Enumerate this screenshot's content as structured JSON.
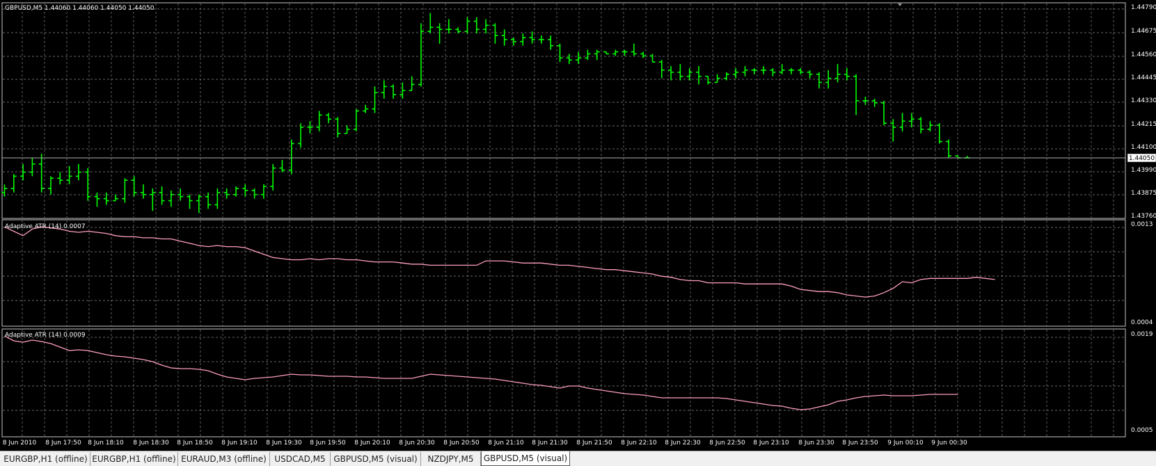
{
  "main_pane": {
    "title": "GBPUSD,M5  1.44060 1.44060 1.44050 1.44050",
    "price_ticks": [
      "1.44790",
      "1.44675",
      "1.44560",
      "1.44445",
      "1.44330",
      "1.44215",
      "1.44100",
      "1.43990",
      "1.43875",
      "1.43760"
    ],
    "current_price": "1.44050"
  },
  "indicator1": {
    "title": "Adaptive ATR (14) 0.0007",
    "ticks": [
      "0.0013",
      "0.0004"
    ]
  },
  "indicator2": {
    "title": "Adaptive ATR (14) 0.0009",
    "ticks": [
      "0.0019",
      "0.0005"
    ]
  },
  "time_axis": [
    "8 Jun 2010",
    "8 Jun 17:50",
    "8 Jun 18:10",
    "8 Jun 18:30",
    "8 Jun 18:50",
    "8 Jun 19:10",
    "8 Jun 19:30",
    "8 Jun 19:50",
    "8 Jun 20:10",
    "8 Jun 20:30",
    "8 Jun 20:50",
    "8 Jun 21:10",
    "8 Jun 21:30",
    "8 Jun 21:50",
    "8 Jun 22:10",
    "8 Jun 22:30",
    "8 Jun 22:50",
    "8 Jun 23:10",
    "8 Jun 23:30",
    "8 Jun 23:50",
    "9 Jun 00:10",
    "9 Jun 00:30"
  ],
  "tabs": [
    {
      "label": "EURGBP,H1 (offline)",
      "active": false
    },
    {
      "label": "EURGBP,H1 (offline)",
      "active": false
    },
    {
      "label": "EURAUD,M3 (offline)",
      "active": false
    },
    {
      "label": "USDCAD,M5",
      "active": false
    },
    {
      "label": "GBPUSD,M5 (visual)",
      "active": false
    },
    {
      "label": "NZDJPY,M5",
      "active": false
    },
    {
      "label": "GBPUSD,M5 (visual)",
      "active": true
    }
  ],
  "colors": {
    "background": "#000000",
    "grid": "#8a8a8a",
    "bars": "#00ff00",
    "indicator_line": "#ff9ec4",
    "text": "#ffffff"
  },
  "chart_data": [
    {
      "type": "bar",
      "title": "GBPUSD,M5",
      "ylim": [
        1.4376,
        1.4479
      ],
      "bars": [
        {
          "o": 1.4388,
          "h": 1.4392,
          "l": 1.4386,
          "c": 1.439
        },
        {
          "o": 1.439,
          "h": 1.4397,
          "l": 1.4388,
          "c": 1.4396
        },
        {
          "o": 1.4396,
          "h": 1.4402,
          "l": 1.4394,
          "c": 1.4398
        },
        {
          "o": 1.4398,
          "h": 1.4405,
          "l": 1.4396,
          "c": 1.4402
        },
        {
          "o": 1.4402,
          "h": 1.4407,
          "l": 1.4388,
          "c": 1.439
        },
        {
          "o": 1.439,
          "h": 1.4396,
          "l": 1.4387,
          "c": 1.4395
        },
        {
          "o": 1.4395,
          "h": 1.4398,
          "l": 1.4392,
          "c": 1.4394
        },
        {
          "o": 1.4394,
          "h": 1.4401,
          "l": 1.4392,
          "c": 1.4396
        },
        {
          "o": 1.4396,
          "h": 1.4402,
          "l": 1.4394,
          "c": 1.4398
        },
        {
          "o": 1.4398,
          "h": 1.44,
          "l": 1.4384,
          "c": 1.4386
        },
        {
          "o": 1.4386,
          "h": 1.4388,
          "l": 1.4381,
          "c": 1.4385
        },
        {
          "o": 1.4385,
          "h": 1.4388,
          "l": 1.4382,
          "c": 1.4384
        },
        {
          "o": 1.4384,
          "h": 1.4387,
          "l": 1.4384,
          "c": 1.4385
        },
        {
          "o": 1.4385,
          "h": 1.4395,
          "l": 1.4383,
          "c": 1.4394
        },
        {
          "o": 1.4394,
          "h": 1.4396,
          "l": 1.4386,
          "c": 1.4388
        },
        {
          "o": 1.4388,
          "h": 1.4392,
          "l": 1.4385,
          "c": 1.4387
        },
        {
          "o": 1.4387,
          "h": 1.439,
          "l": 1.4379,
          "c": 1.4388
        },
        {
          "o": 1.4388,
          "h": 1.4391,
          "l": 1.4382,
          "c": 1.4384
        },
        {
          "o": 1.4384,
          "h": 1.4389,
          "l": 1.4381,
          "c": 1.4387
        },
        {
          "o": 1.4387,
          "h": 1.439,
          "l": 1.4384,
          "c": 1.4386
        },
        {
          "o": 1.4386,
          "h": 1.4387,
          "l": 1.438,
          "c": 1.4384
        },
        {
          "o": 1.4384,
          "h": 1.4387,
          "l": 1.4378,
          "c": 1.4386
        },
        {
          "o": 1.4386,
          "h": 1.4388,
          "l": 1.438,
          "c": 1.4382
        },
        {
          "o": 1.4382,
          "h": 1.439,
          "l": 1.438,
          "c": 1.4388
        },
        {
          "o": 1.4388,
          "h": 1.439,
          "l": 1.4385,
          "c": 1.4387
        },
        {
          "o": 1.4387,
          "h": 1.4391,
          "l": 1.4386,
          "c": 1.439
        },
        {
          "o": 1.439,
          "h": 1.4392,
          "l": 1.4386,
          "c": 1.4389
        },
        {
          "o": 1.4389,
          "h": 1.439,
          "l": 1.4385,
          "c": 1.4387
        },
        {
          "o": 1.4387,
          "h": 1.4392,
          "l": 1.4385,
          "c": 1.4391
        },
        {
          "o": 1.4391,
          "h": 1.4402,
          "l": 1.4389,
          "c": 1.44
        },
        {
          "o": 1.44,
          "h": 1.4404,
          "l": 1.4398,
          "c": 1.4399
        },
        {
          "o": 1.4399,
          "h": 1.4414,
          "l": 1.4397,
          "c": 1.4412
        },
        {
          "o": 1.4412,
          "h": 1.4422,
          "l": 1.441,
          "c": 1.442
        },
        {
          "o": 1.442,
          "h": 1.4423,
          "l": 1.4417,
          "c": 1.442
        },
        {
          "o": 1.442,
          "h": 1.4428,
          "l": 1.4418,
          "c": 1.4426
        },
        {
          "o": 1.4426,
          "h": 1.4427,
          "l": 1.4422,
          "c": 1.4424
        },
        {
          "o": 1.4424,
          "h": 1.4425,
          "l": 1.4415,
          "c": 1.4417
        },
        {
          "o": 1.4417,
          "h": 1.4421,
          "l": 1.4417,
          "c": 1.4419
        },
        {
          "o": 1.4419,
          "h": 1.4429,
          "l": 1.4418,
          "c": 1.4428
        },
        {
          "o": 1.4428,
          "h": 1.4431,
          "l": 1.4427,
          "c": 1.4429
        },
        {
          "o": 1.4429,
          "h": 1.444,
          "l": 1.4427,
          "c": 1.4437
        },
        {
          "o": 1.4437,
          "h": 1.4443,
          "l": 1.4434,
          "c": 1.444
        },
        {
          "o": 1.444,
          "h": 1.4441,
          "l": 1.4434,
          "c": 1.4436
        },
        {
          "o": 1.4436,
          "h": 1.4442,
          "l": 1.4434,
          "c": 1.4438
        },
        {
          "o": 1.4438,
          "h": 1.4445,
          "l": 1.4438,
          "c": 1.4441
        },
        {
          "o": 1.4441,
          "h": 1.4471,
          "l": 1.444,
          "c": 1.4467
        },
        {
          "o": 1.4467,
          "h": 1.4476,
          "l": 1.4466,
          "c": 1.4469
        },
        {
          "o": 1.4469,
          "h": 1.4471,
          "l": 1.4461,
          "c": 1.4468
        },
        {
          "o": 1.4468,
          "h": 1.4473,
          "l": 1.4466,
          "c": 1.4468
        },
        {
          "o": 1.4468,
          "h": 1.4469,
          "l": 1.4466,
          "c": 1.4467
        },
        {
          "o": 1.4467,
          "h": 1.4474,
          "l": 1.4466,
          "c": 1.4472
        },
        {
          "o": 1.4472,
          "h": 1.4474,
          "l": 1.4466,
          "c": 1.4468
        },
        {
          "o": 1.4468,
          "h": 1.4473,
          "l": 1.4466,
          "c": 1.447
        },
        {
          "o": 1.447,
          "h": 1.4471,
          "l": 1.4461,
          "c": 1.4465
        },
        {
          "o": 1.4465,
          "h": 1.4468,
          "l": 1.446,
          "c": 1.4463
        },
        {
          "o": 1.4463,
          "h": 1.4464,
          "l": 1.446,
          "c": 1.4462
        },
        {
          "o": 1.4462,
          "h": 1.4466,
          "l": 1.446,
          "c": 1.4464
        },
        {
          "o": 1.4464,
          "h": 1.4467,
          "l": 1.4461,
          "c": 1.4463
        },
        {
          "o": 1.4463,
          "h": 1.4465,
          "l": 1.4461,
          "c": 1.4463
        },
        {
          "o": 1.4463,
          "h": 1.4465,
          "l": 1.4458,
          "c": 1.446
        },
        {
          "o": 1.446,
          "h": 1.4461,
          "l": 1.4452,
          "c": 1.4454
        },
        {
          "o": 1.4454,
          "h": 1.4456,
          "l": 1.4451,
          "c": 1.4453
        },
        {
          "o": 1.4453,
          "h": 1.4457,
          "l": 1.4451,
          "c": 1.4454
        },
        {
          "o": 1.4454,
          "h": 1.4458,
          "l": 1.4453,
          "c": 1.4456
        },
        {
          "o": 1.4456,
          "h": 1.4458,
          "l": 1.4453,
          "c": 1.4457
        },
        {
          "o": 1.4457,
          "h": 1.4457,
          "l": 1.4456,
          "c": 1.4456
        },
        {
          "o": 1.4456,
          "h": 1.4458,
          "l": 1.4455,
          "c": 1.4457
        },
        {
          "o": 1.4457,
          "h": 1.4458,
          "l": 1.4455,
          "c": 1.4457
        },
        {
          "o": 1.4457,
          "h": 1.4461,
          "l": 1.4455,
          "c": 1.4456
        },
        {
          "o": 1.4456,
          "h": 1.4457,
          "l": 1.4454,
          "c": 1.4455
        },
        {
          "o": 1.4455,
          "h": 1.4456,
          "l": 1.4452,
          "c": 1.4452
        },
        {
          "o": 1.4452,
          "h": 1.4453,
          "l": 1.4444,
          "c": 1.4448
        },
        {
          "o": 1.4448,
          "h": 1.445,
          "l": 1.4443,
          "c": 1.4447
        },
        {
          "o": 1.4447,
          "h": 1.4451,
          "l": 1.4443,
          "c": 1.4445
        },
        {
          "o": 1.4445,
          "h": 1.4449,
          "l": 1.4443,
          "c": 1.4447
        },
        {
          "o": 1.4447,
          "h": 1.445,
          "l": 1.4441,
          "c": 1.4445
        },
        {
          "o": 1.4445,
          "h": 1.4445,
          "l": 1.4441,
          "c": 1.4442
        },
        {
          "o": 1.4442,
          "h": 1.4446,
          "l": 1.4442,
          "c": 1.4444
        },
        {
          "o": 1.4444,
          "h": 1.4447,
          "l": 1.4443,
          "c": 1.4446
        },
        {
          "o": 1.4446,
          "h": 1.4449,
          "l": 1.4444,
          "c": 1.4447
        },
        {
          "o": 1.4447,
          "h": 1.445,
          "l": 1.4445,
          "c": 1.4448
        },
        {
          "o": 1.4448,
          "h": 1.4449,
          "l": 1.4446,
          "c": 1.4448
        },
        {
          "o": 1.4448,
          "h": 1.445,
          "l": 1.4446,
          "c": 1.4448
        },
        {
          "o": 1.4448,
          "h": 1.4449,
          "l": 1.4445,
          "c": 1.4447
        },
        {
          "o": 1.4447,
          "h": 1.4451,
          "l": 1.4446,
          "c": 1.4448
        },
        {
          "o": 1.4448,
          "h": 1.4449,
          "l": 1.4446,
          "c": 1.4448
        },
        {
          "o": 1.4448,
          "h": 1.4449,
          "l": 1.4446,
          "c": 1.4447
        },
        {
          "o": 1.4447,
          "h": 1.4448,
          "l": 1.4444,
          "c": 1.4446
        },
        {
          "o": 1.4446,
          "h": 1.4447,
          "l": 1.4439,
          "c": 1.4442
        },
        {
          "o": 1.4442,
          "h": 1.4448,
          "l": 1.4439,
          "c": 1.4444
        },
        {
          "o": 1.4444,
          "h": 1.4451,
          "l": 1.4442,
          "c": 1.4446
        },
        {
          "o": 1.4446,
          "h": 1.4449,
          "l": 1.4443,
          "c": 1.4445
        },
        {
          "o": 1.4445,
          "h": 1.4446,
          "l": 1.4426,
          "c": 1.4433
        },
        {
          "o": 1.4433,
          "h": 1.4435,
          "l": 1.4431,
          "c": 1.4433
        },
        {
          "o": 1.4433,
          "h": 1.4434,
          "l": 1.443,
          "c": 1.4432
        },
        {
          "o": 1.4432,
          "h": 1.4433,
          "l": 1.4421,
          "c": 1.4422
        },
        {
          "o": 1.4422,
          "h": 1.4424,
          "l": 1.4413,
          "c": 1.442
        },
        {
          "o": 1.442,
          "h": 1.4427,
          "l": 1.4418,
          "c": 1.4423
        },
        {
          "o": 1.4423,
          "h": 1.4427,
          "l": 1.442,
          "c": 1.4424
        },
        {
          "o": 1.4424,
          "h": 1.4425,
          "l": 1.4417,
          "c": 1.4419
        },
        {
          "o": 1.4419,
          "h": 1.4423,
          "l": 1.4418,
          "c": 1.4421
        },
        {
          "o": 1.4421,
          "h": 1.4422,
          "l": 1.4412,
          "c": 1.4413
        },
        {
          "o": 1.4413,
          "h": 1.4414,
          "l": 1.4405,
          "c": 1.4406
        },
        {
          "o": 1.4406,
          "h": 1.4406,
          "l": 1.4405,
          "c": 1.4405
        },
        {
          "o": 1.4405,
          "h": 1.4406,
          "l": 1.4405,
          "c": 1.4405
        }
      ]
    },
    {
      "type": "line",
      "title": "Adaptive ATR (14)",
      "ylim": [
        0.0004,
        0.0013
      ],
      "values": [
        0.00128,
        0.00124,
        0.0012,
        0.00126,
        0.00128,
        0.00127,
        0.00126,
        0.00124,
        0.00123,
        0.00124,
        0.00123,
        0.00122,
        0.0012,
        0.00119,
        0.00119,
        0.00118,
        0.00118,
        0.00117,
        0.00117,
        0.00115,
        0.00113,
        0.00111,
        0.0011,
        0.00111,
        0.0011,
        0.0011,
        0.00109,
        0.00106,
        0.00103,
        0.001,
        0.00099,
        0.00098,
        0.00098,
        0.00099,
        0.00098,
        0.00099,
        0.00099,
        0.00098,
        0.00098,
        0.00097,
        0.00096,
        0.00096,
        0.00096,
        0.00095,
        0.00094,
        0.00094,
        0.00093,
        0.00093,
        0.00093,
        0.00093,
        0.00093,
        0.00093,
        0.00097,
        0.00097,
        0.00097,
        0.00096,
        0.00095,
        0.00095,
        0.00095,
        0.00094,
        0.00093,
        0.00093,
        0.00092,
        0.00091,
        0.0009,
        0.00089,
        0.00089,
        0.00088,
        0.00087,
        0.00086,
        0.00085,
        0.00083,
        0.00082,
        0.0008,
        0.00079,
        0.00079,
        0.00077,
        0.00077,
        0.00077,
        0.00077,
        0.00076,
        0.00076,
        0.00076,
        0.00076,
        0.00076,
        0.00074,
        0.00071,
        0.0007,
        0.00069,
        0.00069,
        0.00068,
        0.00066,
        0.00065,
        0.00064,
        0.00065,
        0.00068,
        0.00072,
        0.00078,
        0.00077,
        0.0008,
        0.00081,
        0.00081,
        0.00081,
        0.00081,
        0.00081,
        0.00082,
        0.00081,
        0.0008
      ]
    },
    {
      "type": "line",
      "title": "Adaptive ATR (14)",
      "ylim": [
        0.0005,
        0.0019
      ],
      "values": [
        0.00187,
        0.0018,
        0.00178,
        0.00181,
        0.00179,
        0.00176,
        0.00171,
        0.00166,
        0.00167,
        0.00166,
        0.00163,
        0.0016,
        0.00158,
        0.00157,
        0.00155,
        0.00153,
        0.0015,
        0.00145,
        0.00141,
        0.0014,
        0.0014,
        0.00139,
        0.00137,
        0.00132,
        0.00128,
        0.00126,
        0.00124,
        0.00126,
        0.00127,
        0.00128,
        0.0013,
        0.00132,
        0.00131,
        0.00131,
        0.0013,
        0.00129,
        0.00129,
        0.00129,
        0.00128,
        0.00128,
        0.00127,
        0.00126,
        0.00126,
        0.00126,
        0.00126,
        0.00129,
        0.00132,
        0.00131,
        0.0013,
        0.00129,
        0.00128,
        0.00127,
        0.00126,
        0.00125,
        0.00123,
        0.00121,
        0.00119,
        0.00117,
        0.00116,
        0.00114,
        0.00112,
        0.00115,
        0.00115,
        0.00112,
        0.0011,
        0.00108,
        0.00106,
        0.00104,
        0.00103,
        0.00102,
        0.001,
        0.00098,
        0.00098,
        0.00098,
        0.00098,
        0.00098,
        0.00098,
        0.00098,
        0.00097,
        0.00095,
        0.00093,
        0.00091,
        0.00089,
        0.00087,
        0.00086,
        0.00083,
        0.00081,
        0.00082,
        0.00085,
        0.00088,
        0.00093,
        0.00095,
        0.00098,
        0.001,
        0.00101,
        0.00102,
        0.00101,
        0.00101,
        0.00101,
        0.00102,
        0.00103,
        0.00103,
        0.00103,
        0.00103
      ]
    }
  ]
}
